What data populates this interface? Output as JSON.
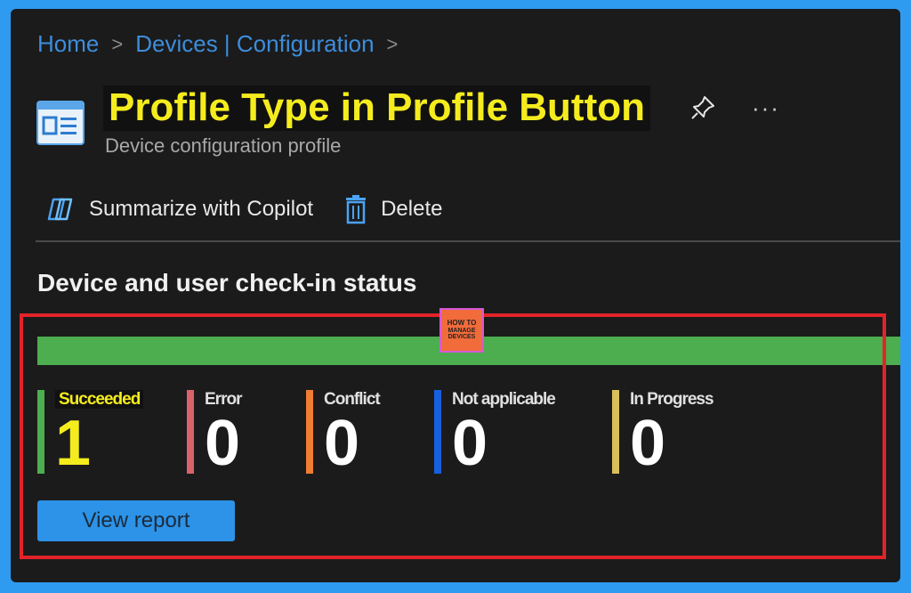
{
  "breadcrumb": {
    "home": "Home",
    "devices": "Devices | Configuration",
    "separator": ">"
  },
  "header": {
    "title": "Profile Type in Profile Button",
    "subtitle": "Device configuration profile",
    "more": "···"
  },
  "toolbar": {
    "summarize_label": "Summarize with Copilot",
    "delete_label": "Delete"
  },
  "section": {
    "title": "Device and user check-in status"
  },
  "watermark": {
    "line1": "HOW TO",
    "line2": "MANAGE",
    "line3": "DEVICES"
  },
  "status": {
    "bar_color": "#4cae4f",
    "tiles": [
      {
        "label": "Succeeded",
        "count": "1",
        "color": "#4cae4f"
      },
      {
        "label": "Error",
        "count": "0",
        "color": "#d9626b"
      },
      {
        "label": "Conflict",
        "count": "0",
        "color": "#ef7d32"
      },
      {
        "label": "Not applicable",
        "count": "0",
        "color": "#1760e0"
      },
      {
        "label": "In Progress",
        "count": "0",
        "color": "#d9bf5c"
      }
    ]
  },
  "actions": {
    "view_report_label": "View report"
  },
  "icons": {
    "profile": "profile-window-icon",
    "pin": "pin-icon",
    "copilot": "copilot-icon",
    "delete": "trash-icon"
  }
}
